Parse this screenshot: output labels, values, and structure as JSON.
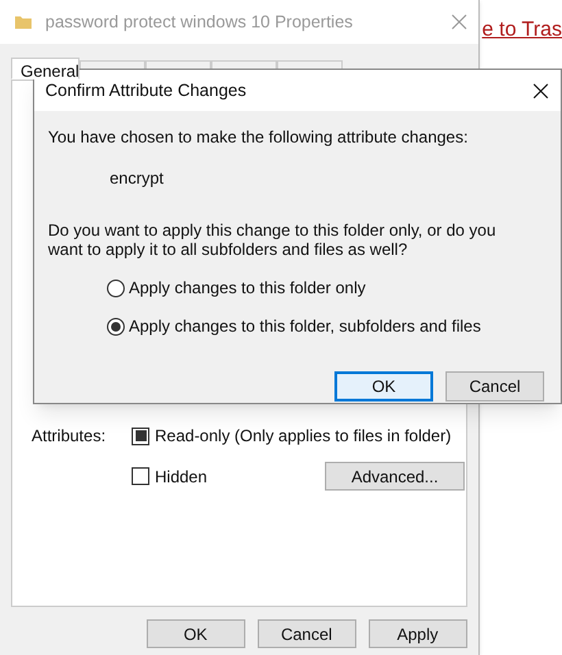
{
  "properties_window": {
    "title": "password protect windows 10 Properties",
    "tabs": [
      {
        "label": "General",
        "selected": true
      },
      {
        "selected": false
      },
      {
        "selected": false
      },
      {
        "selected": false
      },
      {
        "selected": false
      }
    ],
    "attributes_label": "Attributes:",
    "attributes": [
      {
        "label": "Read-only (Only applies to files in folder)",
        "checked": false,
        "indeterminate": true
      },
      {
        "label": "Hidden",
        "checked": false,
        "indeterminate": false
      }
    ],
    "advanced_button": "Advanced...",
    "buttons": [
      "OK",
      "Cancel",
      "Apply"
    ]
  },
  "background_link": "e to Tras",
  "dialog": {
    "title": "Confirm Attribute Changes",
    "intro": "You have chosen to make the following attribute changes:",
    "change": "encrypt",
    "question": "Do you want to apply this change to this folder only, or do you want to apply it to all subfolders and files as well?",
    "options": [
      {
        "label": "Apply changes to this folder only",
        "selected": false
      },
      {
        "label": "Apply changes to this folder, subfolders and files",
        "selected": true
      }
    ],
    "buttons": [
      {
        "label": "OK",
        "default": true
      },
      {
        "label": "Cancel",
        "default": false
      }
    ]
  }
}
